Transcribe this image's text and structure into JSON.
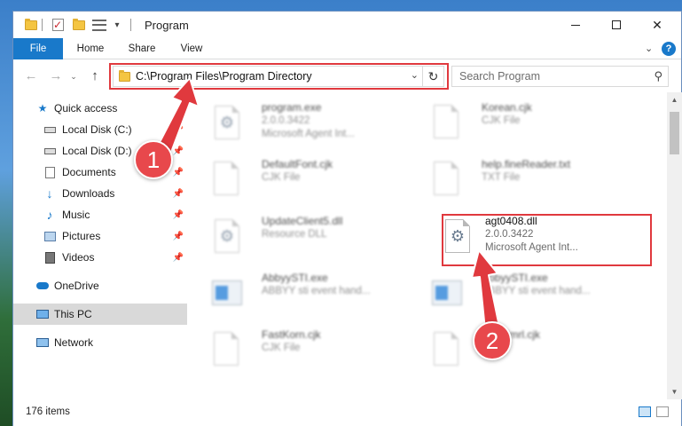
{
  "window": {
    "title": "Program",
    "controls": {
      "minimize": "min",
      "maximize": "max",
      "close": "✕"
    }
  },
  "ribbon": {
    "tabs": [
      "File",
      "Home",
      "Share",
      "View"
    ]
  },
  "navbar": {
    "back": "←",
    "forward": "→",
    "up": "↑",
    "address": "C:\\Program Files\\Program Directory",
    "refresh": "↻",
    "search_placeholder": "Search Program"
  },
  "sidebar": {
    "items": [
      {
        "label": "Quick access",
        "icon": "star-icon",
        "pinned": false
      },
      {
        "label": "Local Disk (C:)",
        "icon": "disk-icon",
        "pinned": true
      },
      {
        "label": "Local Disk (D:)",
        "icon": "disk-icon",
        "pinned": true
      },
      {
        "label": "Documents",
        "icon": "documents-icon",
        "pinned": true
      },
      {
        "label": "Downloads",
        "icon": "download-icon",
        "pinned": true
      },
      {
        "label": "Music",
        "icon": "music-icon",
        "pinned": true
      },
      {
        "label": "Pictures",
        "icon": "pictures-icon",
        "pinned": true
      },
      {
        "label": "Videos",
        "icon": "videos-icon",
        "pinned": true
      },
      {
        "label": "OneDrive",
        "icon": "cloud-icon",
        "pinned": false
      },
      {
        "label": "This PC",
        "icon": "computer-icon",
        "pinned": false,
        "selected": true
      },
      {
        "label": "Network",
        "icon": "network-icon",
        "pinned": false
      }
    ]
  },
  "files": [
    {
      "name": "program.exe",
      "line2": "2.0.0.3422",
      "line3": "Microsoft Agent Int...",
      "icon": "installer-icon",
      "blurred": true
    },
    {
      "name": "Korean.cjk",
      "line2": "CJK File",
      "line3": "",
      "icon": "file-icon",
      "blurred": true
    },
    {
      "name": "DefaultFont.cjk",
      "line2": "CJK File",
      "line3": "",
      "icon": "file-icon",
      "blurred": true
    },
    {
      "name": "help.fineReader.txt",
      "line2": "TXT File",
      "line3": "",
      "icon": "file-icon",
      "blurred": true
    },
    {
      "name": "UpdateClient5.dll",
      "line2": "Resource DLL",
      "line3": "",
      "icon": "dll-icon",
      "blurred": true
    },
    {
      "name": "agt0408.dll",
      "line2": "2.0.0.3422",
      "line3": "Microsoft Agent Int...",
      "icon": "dll-icon",
      "blurred": false
    },
    {
      "name": "AbbyySTI.exe",
      "line2": "ABBYY sti event hand...",
      "line3": "",
      "icon": "exe-icon",
      "blurred": true
    },
    {
      "name": "AbbyySTI.exe",
      "line2": "ABBYY sti event hand...",
      "line3": "",
      "icon": "exe-icon",
      "blurred": true
    },
    {
      "name": "FastKorn.cjk",
      "line2": "CJK File",
      "line3": "",
      "icon": "file-icon",
      "blurred": true
    },
    {
      "name": "FastKmrl.cjk",
      "line2": "",
      "line3": "",
      "icon": "file-icon",
      "blurred": true
    }
  ],
  "status": {
    "item_count": "176 items"
  },
  "callouts": {
    "one": "1",
    "two": "2",
    "color": "#e0393e"
  },
  "colors": {
    "accent": "#1979ca",
    "highlight": "#e0393e",
    "selected_bg": "#d9d9d9"
  }
}
